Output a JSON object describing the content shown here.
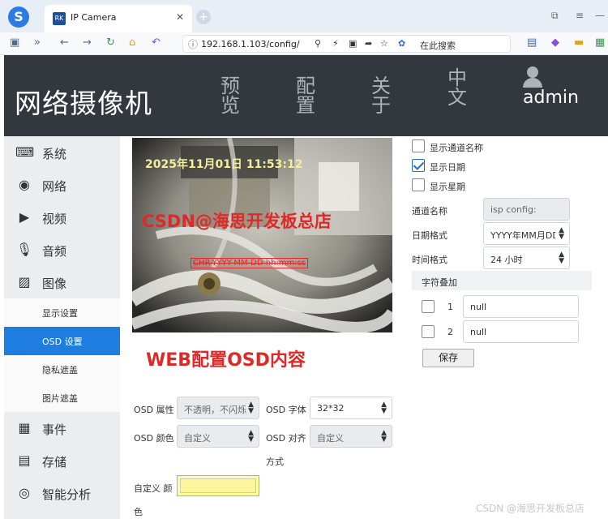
{
  "browser": {
    "logo": "S",
    "tab_favicon": "RK",
    "tab_title": "IP Camera",
    "tab_close": "✕",
    "new_tab": "+",
    "url": "192.168.1.103/config/",
    "search_engine": "在此搜索"
  },
  "header": {
    "app_title": "网络摄像机",
    "nav": [
      "预览",
      "配置",
      "关于",
      "中文"
    ],
    "username": "admin"
  },
  "sidebar": {
    "items": [
      {
        "label": "系统",
        "icon": "keyboard-icon"
      },
      {
        "label": "网络",
        "icon": "globe-icon"
      },
      {
        "label": "视频",
        "icon": "video-icon"
      },
      {
        "label": "音频",
        "icon": "microphone-icon"
      },
      {
        "label": "图像",
        "icon": "image-icon"
      }
    ],
    "sub_items": [
      {
        "label": "显示设置",
        "active": false
      },
      {
        "label": "OSD 设置",
        "active": true
      },
      {
        "label": "隐私遮盖",
        "active": false
      },
      {
        "label": "图片遮盖",
        "active": false
      }
    ],
    "items_after": [
      {
        "label": "事件",
        "icon": "event-icon"
      },
      {
        "label": "存储",
        "icon": "storage-icon"
      },
      {
        "label": "智能分析",
        "icon": "analysis-icon"
      }
    ]
  },
  "preview": {
    "osd_time": "2025年11月01日 11:53:12",
    "watermark": "CSDN@海思开发板总店",
    "osd_template": "CHR-YYYY-MM-DD hh:mm:ss",
    "caption": "WEB配置OSD内容"
  },
  "osd_form": {
    "attr_label": "OSD 属性",
    "attr_value": "不透明，不闪烁",
    "font_label": "OSD 字体",
    "font_value": "32*32",
    "color_label": "OSD 颜色",
    "color_value": "自定义",
    "align_label_1": "OSD 对齐",
    "align_label_2": "方式",
    "align_value": "自定义",
    "custom_color_label_1": "自定义 颜",
    "custom_color_label_2": "色",
    "custom_color_hex": "#fff59d"
  },
  "display": {
    "show_channel_name": {
      "label": "显示通道名称",
      "checked": false
    },
    "show_date": {
      "label": "显示日期",
      "checked": true
    },
    "show_week": {
      "label": "显示星期",
      "checked": false
    },
    "channel_name_label": "通道名称",
    "channel_name_value": "isp config:",
    "date_format_label": "日期格式",
    "date_format_value": "YYYY年MM月DD日",
    "time_format_label": "时间格式",
    "time_format_value": "24 小时"
  },
  "overlay": {
    "title": "字符叠加",
    "rows": [
      {
        "num": "1",
        "value": "null",
        "checked": false
      },
      {
        "num": "2",
        "value": "null",
        "checked": false
      }
    ],
    "save_label": "保存"
  },
  "footer_watermark": "CSDN @海思开发板总店",
  "colors": {
    "header_bg": "#33383e",
    "active_sub": "#1e7ee0",
    "red_annotation": "#e12828"
  }
}
